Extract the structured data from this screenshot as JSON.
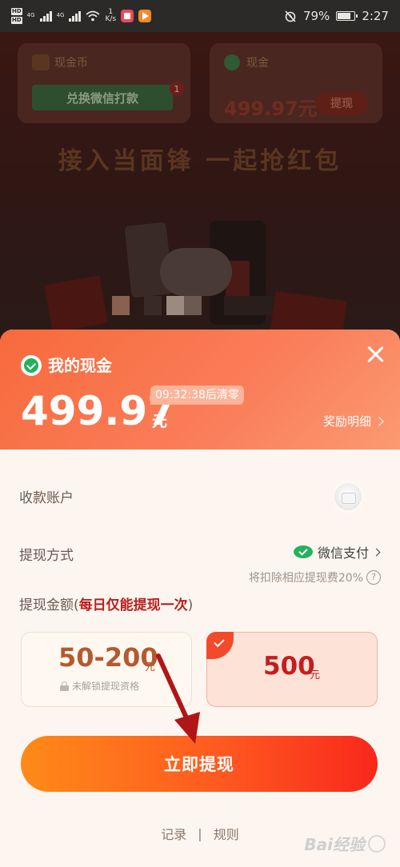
{
  "status_bar": {
    "hd1": "HD",
    "hd2": "HD",
    "net1": "4G",
    "net2": "4G",
    "speed_value": "1",
    "speed_unit": "K/s",
    "battery": "79%",
    "time": "2:27"
  },
  "background": {
    "card1_label": "现金币",
    "card1_button": "兑换微信打款",
    "card1_badge": "1",
    "card2_label": "现金",
    "card2_amount": "499.97元",
    "card2_button": "提现",
    "headline": "接入当面锋 一起抢红包"
  },
  "sheet": {
    "title": "我的现金",
    "amount": "499.97",
    "unit": "元",
    "countdown": "09:32:38后清零",
    "reward_link": "奖励明细",
    "account_label": "收款账户",
    "method_label": "提现方式",
    "method_value": "微信支付",
    "fee_note": "将扣除相应提现费20%",
    "fee_help": "?",
    "amount_label_prefix": "提现金额(",
    "amount_label_note": "每日仅能提现一次",
    "amount_label_suffix": ")",
    "options": [
      {
        "value": "50-200",
        "unit": "元",
        "lock_text": "未解锁提现资格",
        "selected": false
      },
      {
        "value": "500",
        "unit": "元",
        "selected": true
      }
    ],
    "withdraw_button": "立即提现",
    "footer_record": "记录",
    "footer_sep": "|",
    "footer_rules": "规则"
  },
  "watermark": "Bai经验",
  "colors": {
    "accent_orange": "#f76a3c",
    "button_start": "#ff8a18",
    "button_end": "#f8281c",
    "highlight_red": "#c51d1d",
    "wechat_green": "#22b35a",
    "arrow_red": "#b01616"
  }
}
